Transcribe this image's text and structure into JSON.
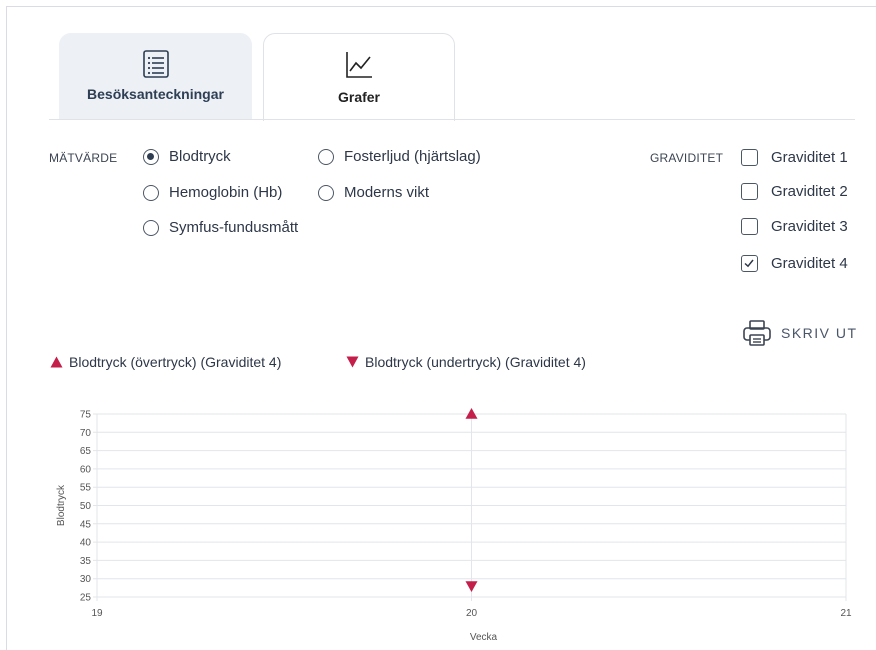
{
  "tabs": [
    {
      "label": "Besöksanteckningar",
      "icon": "list-icon",
      "active": false
    },
    {
      "label": "Grafer",
      "icon": "line-chart-icon",
      "active": true
    }
  ],
  "filters": {
    "measure_label": "MÄTVÄRDE",
    "measures": [
      {
        "label": "Blodtryck",
        "checked": true
      },
      {
        "label": "Fosterljud (hjärtslag)",
        "checked": false
      },
      {
        "label": "Hemoglobin (Hb)",
        "checked": false
      },
      {
        "label": "Moderns vikt",
        "checked": false
      },
      {
        "label": "Symfus-fundusmått",
        "checked": false
      }
    ],
    "pregnancy_label": "GRAVIDITET",
    "pregnancies": [
      {
        "label": "Graviditet 1",
        "checked": false
      },
      {
        "label": "Graviditet 2",
        "checked": false
      },
      {
        "label": "Graviditet 3",
        "checked": false
      },
      {
        "label": "Graviditet 4",
        "checked": true
      }
    ]
  },
  "print_label": "SKRIV UT",
  "colors": {
    "accent": "#c41e4a",
    "radio": "#2f3d52"
  },
  "chart_data": {
    "type": "scatter",
    "xlabel": "Vecka",
    "ylabel": "Blodtryck",
    "xlim": [
      19,
      21
    ],
    "ylim": [
      25,
      75
    ],
    "x_ticks": [
      "19",
      "20",
      "21"
    ],
    "y_ticks": [
      "25",
      "30",
      "35",
      "40",
      "45",
      "50",
      "55",
      "60",
      "65",
      "70",
      "75"
    ],
    "grid": true,
    "legend_position": "top-left",
    "series": [
      {
        "name": "Blodtryck (övertryck) (Graviditet 4)",
        "marker": "triangle-up",
        "color": "#c41e4a",
        "points": [
          {
            "x": 20,
            "y": 75
          }
        ]
      },
      {
        "name": "Blodtryck (undertryck) (Graviditet 4)",
        "marker": "triangle-down",
        "color": "#c41e4a",
        "points": [
          {
            "x": 20,
            "y": 28
          }
        ]
      }
    ]
  }
}
